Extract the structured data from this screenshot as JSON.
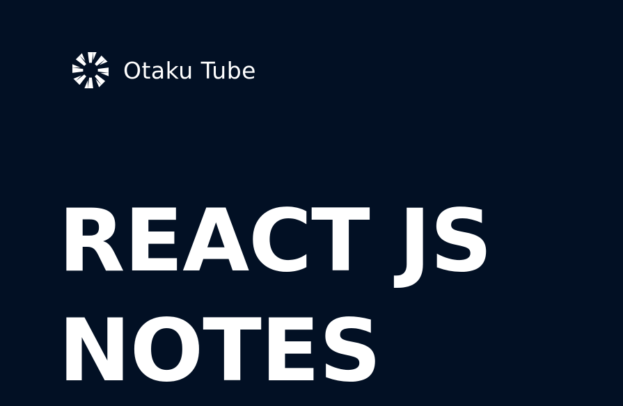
{
  "brand": {
    "logo_icon": "sunburst-logo-icon",
    "name": "Otaku Tube"
  },
  "headline": {
    "line1": "REACT JS",
    "line2": "NOTES"
  },
  "colors": {
    "background": "#021024",
    "text": "#ffffff"
  }
}
